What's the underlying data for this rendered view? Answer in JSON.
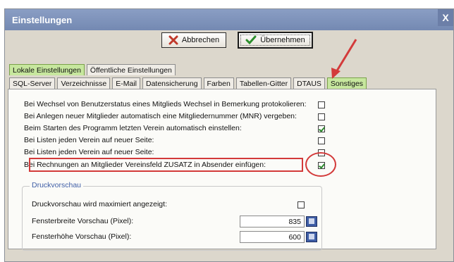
{
  "window": {
    "title": "Einstellungen",
    "close_glyph": "X"
  },
  "buttons": {
    "cancel": {
      "label": "Abbrechen",
      "icon": "x-icon",
      "icon_color": "#c0392b"
    },
    "ok": {
      "label": "Übernehmen",
      "icon": "checkmark-icon",
      "icon_color": "#2d8f2d"
    }
  },
  "main_tabs": [
    {
      "label": "Lokale Einstellungen",
      "active": true
    },
    {
      "label": "Öffentliche Einstellungen",
      "active": false
    }
  ],
  "sub_tabs": [
    {
      "label": "SQL-Server",
      "active": false
    },
    {
      "label": "Verzeichnisse",
      "active": false
    },
    {
      "label": "E-Mail",
      "active": false
    },
    {
      "label": "Datensicherung",
      "active": false
    },
    {
      "label": "Farben",
      "active": false
    },
    {
      "label": "Tabellen-Gitter",
      "active": false
    },
    {
      "label": "DTAUS",
      "active": false
    },
    {
      "label": "Sonstiges",
      "active": true
    }
  ],
  "settings": [
    {
      "label": "Bei Wechsel von Benutzerstatus eines Mitglieds Wechsel in Bemerkung protokolieren:",
      "checked": false
    },
    {
      "label": "Bei Anlegen neuer Mitglieder automatisch eine Mitgliedernummer (MNR) vergeben:",
      "checked": false
    },
    {
      "label": "Beim Starten des Programm letzten Verein automatisch einstellen:",
      "checked": true
    },
    {
      "label": "Bei Listen jeden Verein auf neuer Seite:",
      "checked": false
    },
    {
      "label": "Bei Listen jeden Verein auf neuer Seite:",
      "checked": false
    },
    {
      "label": "Bei Rechnungen an Mitglieder Vereinsfeld ZUSATZ in Absender einfügen:",
      "checked": true
    }
  ],
  "druckvorschau": {
    "title": "Druckvorschau",
    "maximized_label": "Druckvorschau wird maximiert angezeigt:",
    "maximized_checked": false,
    "width_label": "Fensterbreite Vorschau (Pixel):",
    "width_value": "835",
    "height_label": "Fensterhöhe Vorschau (Pixel):",
    "height_value": "600"
  },
  "colors": {
    "accent_green": "#c7e79e",
    "annotation_red": "#d33a3a",
    "group_title": "#3f5ea6"
  }
}
